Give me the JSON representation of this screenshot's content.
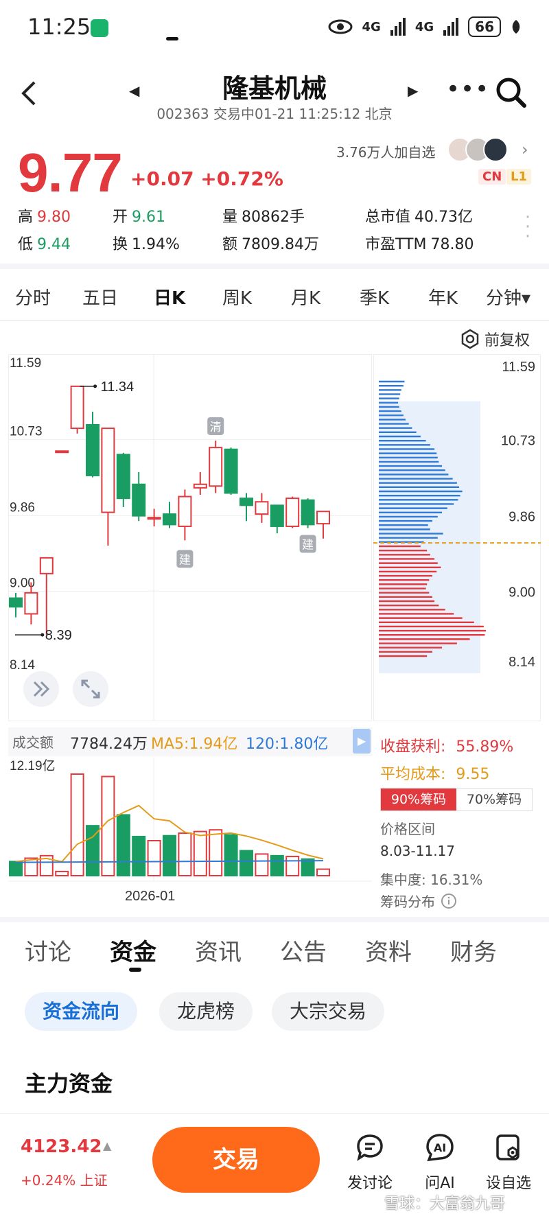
{
  "status": {
    "time": "11:25",
    "net1": "4G",
    "net2": "4G",
    "battery": "66"
  },
  "header": {
    "name": "隆基机械",
    "sub": "002363 交易中01-21 11:25:12 北京",
    "back_icon": "chevron-left-icon",
    "more_label": "•••"
  },
  "quote": {
    "price": "9.77",
    "change": "+0.07 +0.72%",
    "followers": "3.76万人加自选",
    "badge_cn": "CN",
    "badge_l1": "L1"
  },
  "stats": {
    "high_label": "高",
    "high": "9.80",
    "open_label": "开",
    "open": "9.61",
    "vol_label": "量",
    "vol": "80862手",
    "mcap_label": "总市值",
    "mcap": "40.73亿",
    "low_label": "低",
    "low": "9.44",
    "turn_label": "换",
    "turn": "1.94%",
    "amt_label": "额",
    "amt": "7809.84万",
    "pe_label": "市盈TTM",
    "pe": "78.80"
  },
  "period_tabs": [
    "分时",
    "五日",
    "日K",
    "周K",
    "月K",
    "季K",
    "年K",
    "分钟▾"
  ],
  "fuquan": "前复权",
  "chart_data": {
    "type": "candlestick",
    "y_ticks": [
      "11.59",
      "10.73",
      "9.86",
      "9.00",
      "8.14"
    ],
    "ylim": [
      8.14,
      11.59
    ],
    "max_label": "11.34",
    "min_label": "8.39",
    "markers": [
      {
        "text": "清"
      },
      {
        "text": "建"
      },
      {
        "text": "建"
      }
    ],
    "candles": [
      {
        "o": 8.92,
        "c": 8.82,
        "h": 8.98,
        "l": 8.7
      },
      {
        "o": 8.74,
        "c": 8.98,
        "h": 9.1,
        "l": 8.62
      },
      {
        "o": 9.2,
        "c": 9.38,
        "h": 9.38,
        "l": 8.5
      },
      {
        "o": 10.6,
        "c": 10.6,
        "h": 10.6,
        "l": 10.6
      },
      {
        "o": 10.86,
        "c": 11.34,
        "h": 11.34,
        "l": 10.8
      },
      {
        "o": 10.9,
        "c": 10.32,
        "h": 11.05,
        "l": 10.3
      },
      {
        "o": 9.9,
        "c": 10.86,
        "h": 10.86,
        "l": 9.52
      },
      {
        "o": 10.56,
        "c": 10.06,
        "h": 10.58,
        "l": 9.96
      },
      {
        "o": 10.22,
        "c": 9.86,
        "h": 10.36,
        "l": 9.8
      },
      {
        "o": 9.84,
        "c": 9.84,
        "h": 9.94,
        "l": 9.74
      },
      {
        "o": 9.88,
        "c": 9.76,
        "h": 10.02,
        "l": 9.72
      },
      {
        "o": 9.74,
        "c": 10.08,
        "h": 10.16,
        "l": 9.58
      },
      {
        "o": 10.18,
        "c": 10.22,
        "h": 10.36,
        "l": 10.1
      },
      {
        "o": 10.2,
        "c": 10.64,
        "h": 10.72,
        "l": 10.12
      },
      {
        "o": 10.62,
        "c": 10.12,
        "h": 10.64,
        "l": 10.1
      },
      {
        "o": 10.06,
        "c": 9.98,
        "h": 10.12,
        "l": 9.8
      },
      {
        "o": 9.88,
        "c": 10.02,
        "h": 10.12,
        "l": 9.78
      },
      {
        "o": 9.98,
        "c": 9.74,
        "h": 9.98,
        "l": 9.66
      },
      {
        "o": 9.74,
        "c": 10.06,
        "h": 10.08,
        "l": 9.72
      },
      {
        "o": 10.04,
        "c": 9.76,
        "h": 10.06,
        "l": 9.72
      },
      {
        "o": 9.77,
        "c": 9.91,
        "h": 9.91,
        "l": 9.6
      }
    ],
    "up_color": "#e1393d",
    "down_color": "#1a9d62",
    "volume": {
      "legend_label": "成交额",
      "current": "7784.24万",
      "ma5": "MA5:1.94亿",
      "ma120": "120:1.80亿",
      "max_label": "12.19亿",
      "x_label": "2026-01",
      "values": [
        1.7,
        2.1,
        2.4,
        0.5,
        12.19,
        6.0,
        11.9,
        7.3,
        4.7,
        4.2,
        4.8,
        5.1,
        5.3,
        5.5,
        4.9,
        3.0,
        2.6,
        2.4,
        2.3,
        2.0,
        0.78
      ]
    }
  },
  "chip": {
    "price_ticks": [
      "11.59",
      "10.73",
      "9.86",
      "9.00",
      "8.14"
    ],
    "profit_label": "收盘获利:",
    "profit": "55.89%",
    "avg_label": "平均成本:",
    "avg": "9.55",
    "tab90": "90%筹码",
    "tab70": "70%筹码",
    "range_label": "价格区间",
    "range": "8.03-11.17",
    "conc_label": "集中度:",
    "conc": "16.31%",
    "dist_label": "筹码分布"
  },
  "bottom_tabs": [
    "讨论",
    "资金",
    "资讯",
    "公告",
    "资料",
    "财务"
  ],
  "pills": [
    "资金流向",
    "龙虎榜",
    "大宗交易"
  ],
  "section_title": "主力资金",
  "bottom_bar": {
    "index_value": "4123.42",
    "index_change": "+0.24% 上证",
    "trade": "交易",
    "nav": [
      "发讨论",
      "问AI",
      "设自选"
    ]
  },
  "watermark": "雪球：大富翁九哥"
}
